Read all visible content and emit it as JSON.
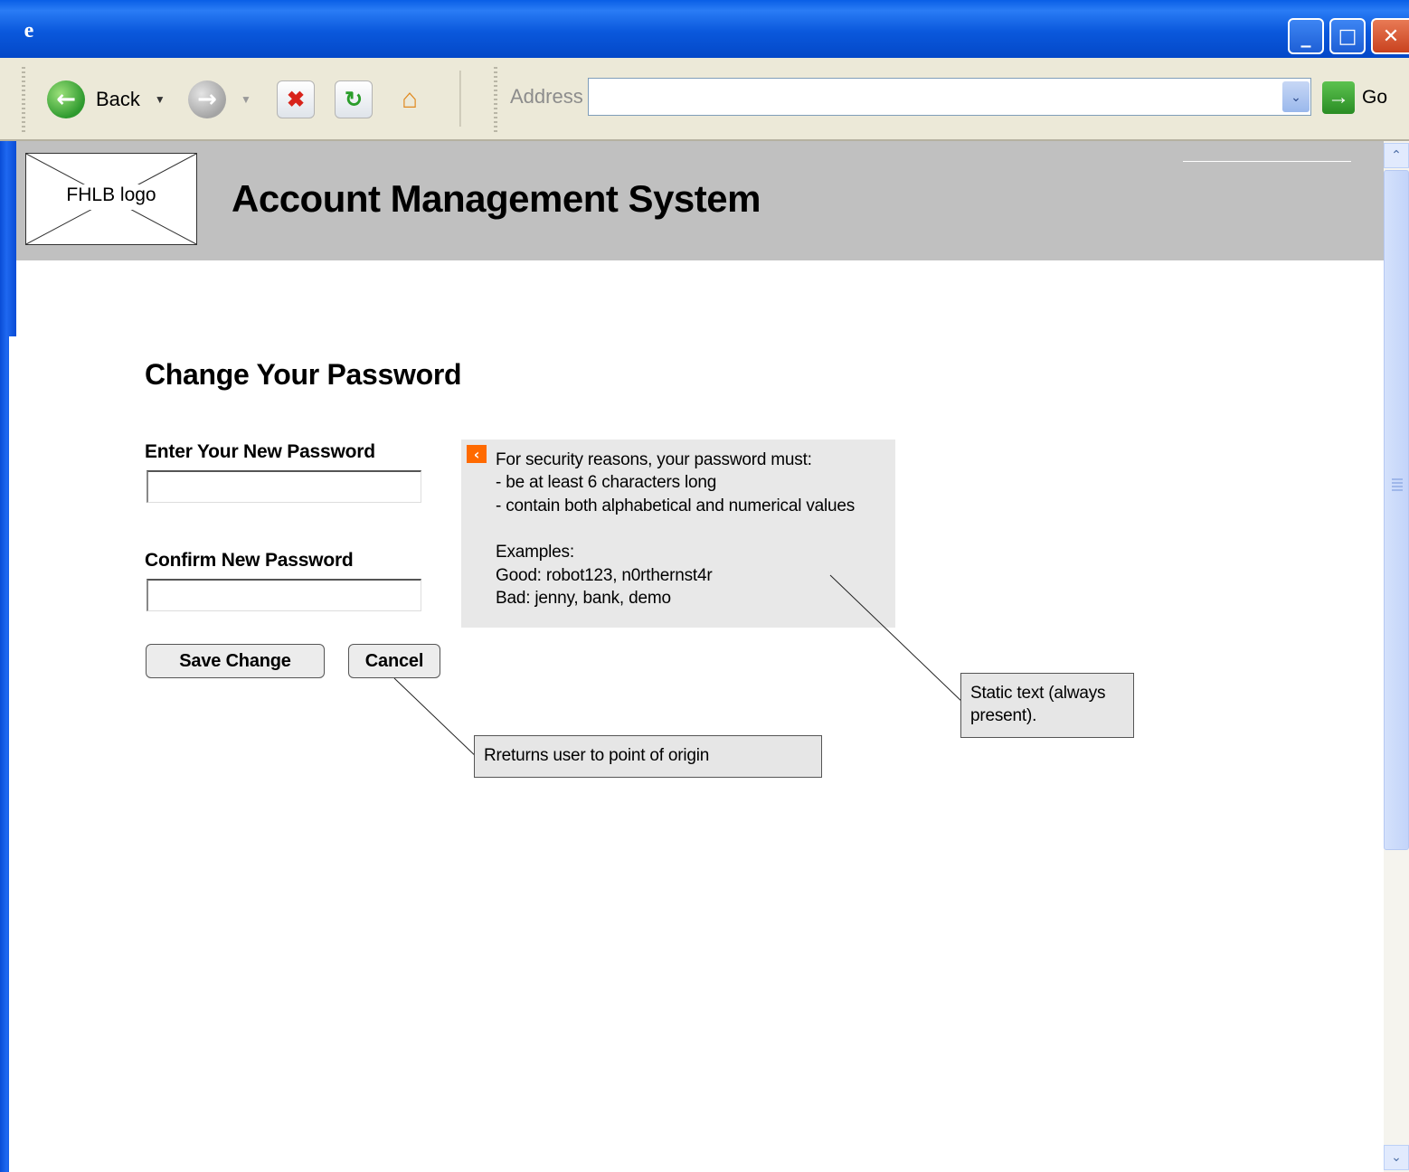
{
  "browser": {
    "logo_glyph": "e",
    "buttons": {
      "minimize_glyph": "_",
      "maximize_glyph": "□",
      "close_glyph": "✕"
    },
    "toolbar": {
      "back_label": "Back",
      "back_glyph": "←",
      "forward_glyph": "→",
      "stop_glyph": "✖",
      "refresh_glyph": "↻",
      "home_glyph": "⌂",
      "dropdown_glyph": "▼",
      "address_label": "Address",
      "address_value": "",
      "address_dropdown_glyph": "⌄",
      "go_glyph": "→",
      "go_label": "Go"
    },
    "scrollbar": {
      "up_glyph": "⌃",
      "down_glyph": "⌄"
    },
    "colors": {
      "titlebar": "#0a58dc",
      "toolbar": "#ece9d8"
    }
  },
  "header": {
    "logo_text": "FHLB logo",
    "title": "Account Management System",
    "background": "#c0c0c0"
  },
  "form": {
    "heading": "Change Your Password",
    "new_password_label": "Enter Your New Password",
    "new_password_value": "",
    "confirm_password_label": "Confirm New Password",
    "confirm_password_value": "",
    "save_button": "Save Change",
    "cancel_button": "Cancel"
  },
  "info": {
    "icon_glyph": "‹",
    "icon_color": "#ff6a00",
    "lines": [
      "For security reasons, your password must:",
      "- be at least 6 characters long",
      "- contain both alphabetical and numerical values",
      "Examples:",
      "Good: robot123, n0rthernst4r",
      "Bad: jenny, bank, demo"
    ]
  },
  "annotations": {
    "static_text_note": "Static text (always present).",
    "cancel_note": "Rreturns user to point of origin"
  }
}
